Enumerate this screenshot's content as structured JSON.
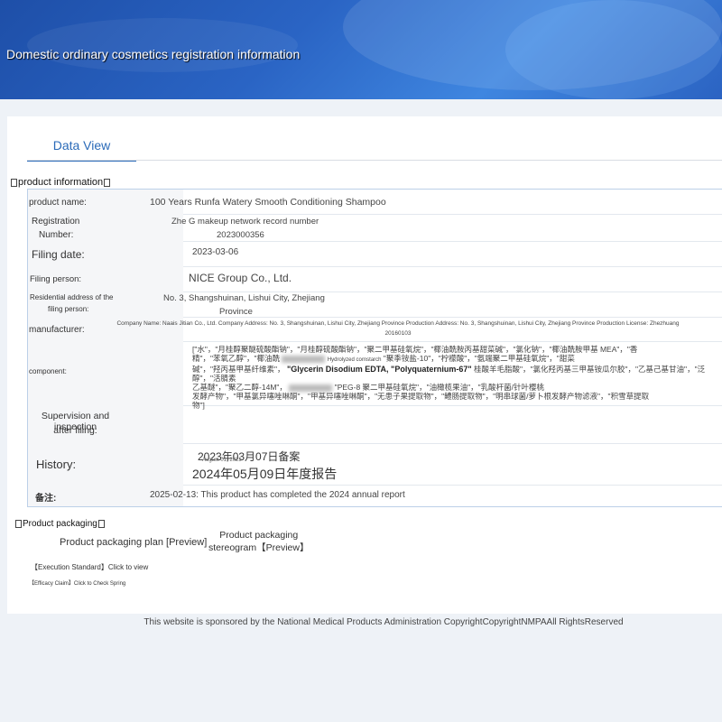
{
  "header": {
    "title": "Domestic ordinary cosmetics registration information"
  },
  "tabs": [
    {
      "label": "Data View"
    }
  ],
  "product_info": {
    "section_title": "product information",
    "rows": {
      "product_name": {
        "label": "product name:",
        "value": "100 Years Runfa Watery Smooth Conditioning Shampoo"
      },
      "registration_number": {
        "label_line1": "Registration",
        "label_line2": "Number:",
        "value_line1": "Zhe G makeup network record number",
        "value_line2": "2023000356"
      },
      "filing_date": {
        "label": "Filing date:",
        "value": "2023-03-06"
      },
      "filing_person": {
        "label": "Filing person:",
        "value": "NICE Group Co., Ltd."
      },
      "residential_address": {
        "label_line1": "Residential address of the",
        "label_line2": "filing person:",
        "value_line1": "No. 3, Shangshuinan, Lishui City, Zhejiang",
        "value_line2": "Province"
      },
      "manufacturer": {
        "label": "manufacturer:",
        "value_line1": "Company Name: Naais Jitian Co., Ltd. Company Address: No. 3, Shangshuinan, Lishui City, Zhejiang Province Production Address: No. 3, Shangshuinan, Lishui City, Zhejiang Province Production License: Zhezhuang",
        "value_line2": "20160103"
      },
      "component": {
        "label": "component:",
        "overlay_small": "Hydrolyzed cornstarch",
        "overlay_main": "\"Glycerin Disodium EDTA, \"Polyquaternium-67\"",
        "line1": "[\"水\"，\"月桂醇聚醚硫酸酯钠\"，\"月桂醇硫酸酯钠\"，\"聚二甲基硅氧烷\"，\"椰油酰胺丙基甜菜碱\"，\"氯化钠\"，\"椰油酰胺甲基 MEA\"，\"香",
        "line2": "精\"，\"苯氧乙醇\"，\"椰油酰",
        "line2b": "\"聚季铵盐-10\"，\"柠檬酸\"，\"氨端聚二甲基硅氧烷\"，\"甜菜",
        "line3": "碱\"，\"羟丙基甲基纤维素\"，",
        "line3b": "桂酸羊毛脂酸\"，\"氯化羟丙基三甲基铵瓜尔胶\"，\"乙基己基甘油\"，\"泛醇\"，\"活腈素",
        "line4": "乙基醚\"，\"聚乙二醇-14M\"，",
        "line4b": "\"PEG-8 聚二甲基硅氧烷\"，\"油橄榄果油\"，\"乳酸杆菌/针叶樱桃",
        "line5": "发酵产物\"，\"甲基氯异噻唑啉酮\"，\"甲基异噻唑啉酮\"，\"无患子果提取物\"，\"鳢肠提取物\"，\"明串球菌/萝卜根发酵产物滤液\"，\"积雪草提取",
        "line6": "物\"]"
      },
      "supervision": {
        "label_line1": "Supervision and inspection",
        "label_line2": "after filing:",
        "value": ""
      },
      "history": {
        "label": "History:",
        "entry1": "2023年03月07日备案",
        "entry1_small": "August 01, 2023",
        "entry2": "2024年05月09日年度报告"
      },
      "remarks": {
        "label": "备注:",
        "value": "2025-02-13: This product has completed the 2024 annual report"
      }
    }
  },
  "product_packaging": {
    "section_title": "Product packaging",
    "plan_link": "Product packaging plan [Preview]",
    "stereogram_line1": "Product packaging",
    "stereogram_line2": "stereogram【Preview】",
    "execution_standard": "【Execution Standard】Click to view",
    "efficacy_claim": "【Efficacy Claim】Click to Check Spring"
  },
  "footer": {
    "copyright": "This website is sponsored by the National Medical Products Administration CopyrightCopyrightNMPAAll RightsReserved"
  },
  "colors": {
    "banner": "#2a64c4",
    "tab_accent": "#2a6ab8",
    "label_bg": "#f5f6f8"
  }
}
